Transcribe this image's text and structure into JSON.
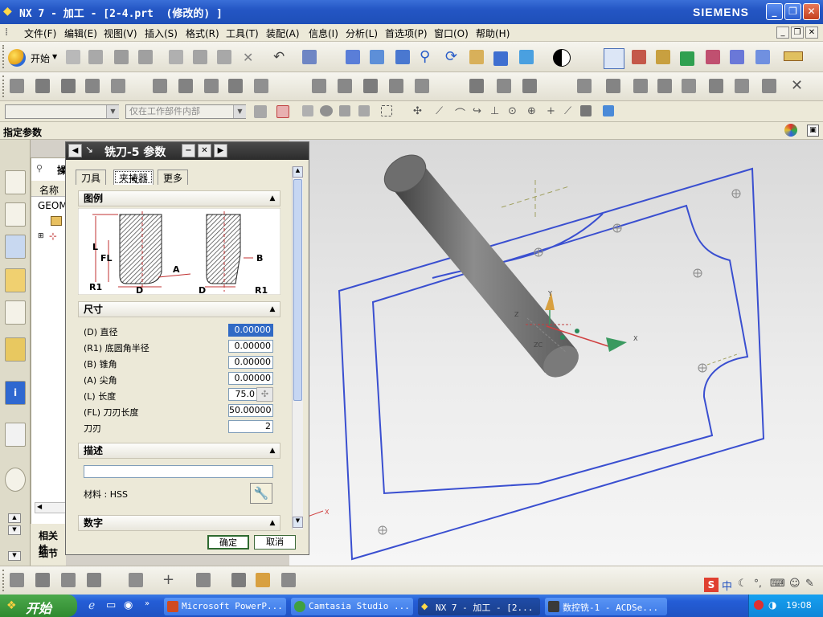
{
  "window": {
    "title": "NX 7 - 加工 - [2-4.prt  (修改的) ]",
    "brand": "SIEMENS",
    "controls": {
      "minimize": "_",
      "restore": "❐",
      "close": "✕"
    }
  },
  "menu": {
    "items": [
      "文件(F)",
      "编辑(E)",
      "视图(V)",
      "插入(S)",
      "格式(R)",
      "工具(T)",
      "装配(A)",
      "信息(I)",
      "分析(L)",
      "首选项(P)",
      "窗口(O)",
      "帮助(H)"
    ]
  },
  "toolbar": {
    "start_label": "开始",
    "filter_placeholder": "",
    "scope_value": "仅在工作部件内部"
  },
  "cue": {
    "text": "指定参数"
  },
  "navigator": {
    "col_name": "名称",
    "row1": "GEOM",
    "header_partial": "操",
    "bottom_labels": [
      "相关性",
      "细节"
    ]
  },
  "dialog": {
    "title": "铣刀-5 参数",
    "tabs": [
      "刀具",
      "夹持器",
      "更多"
    ],
    "active_tab": "夹持器",
    "sections": {
      "legend": "图例",
      "dimensions": "尺寸",
      "description": "描述",
      "number": "数字"
    },
    "diagram_labels": {
      "L": "L",
      "FL": "FL",
      "R1_left": "R1",
      "D_left": "D",
      "A": "A",
      "B": "B",
      "D_right": "D",
      "R1_right": "R1"
    },
    "params": [
      {
        "label": "(D) 直径",
        "value": "0.00000",
        "selected": true
      },
      {
        "label": "(R1) 底圆角半径",
        "value": "0.00000"
      },
      {
        "label": "(B) 锥角",
        "value": "0.00000"
      },
      {
        "label": "(A) 尖角",
        "value": "0.00000"
      },
      {
        "label": "(L) 长度",
        "value": "75.0"
      },
      {
        "label": "(FL) 刀刃长度",
        "value": "50.00000"
      },
      {
        "label": "刀刃",
        "value": "2"
      }
    ],
    "description_value": "",
    "material_label": "材料 : HSS",
    "ok": "确定",
    "cancel": "取消"
  },
  "viewport": {
    "axis_labels": {
      "x": "X",
      "y": "Y",
      "z": "Z",
      "zc": "ZC"
    }
  },
  "taskbar": {
    "start": "开始",
    "tasks": [
      "Microsoft PowerP...",
      "Camtasia Studio ...",
      "NX 7 - 加工 - [2...",
      "数控铣-1 - ACDSe..."
    ],
    "active_task": "NX 7 - 加工 - [2...",
    "clock": "19:08"
  },
  "colors": {
    "title_blue": "#2456c4",
    "dialog_title": "#2c2c2c",
    "part_outline": "#3a4fd0",
    "tool_gray": "#6f6f6f"
  }
}
